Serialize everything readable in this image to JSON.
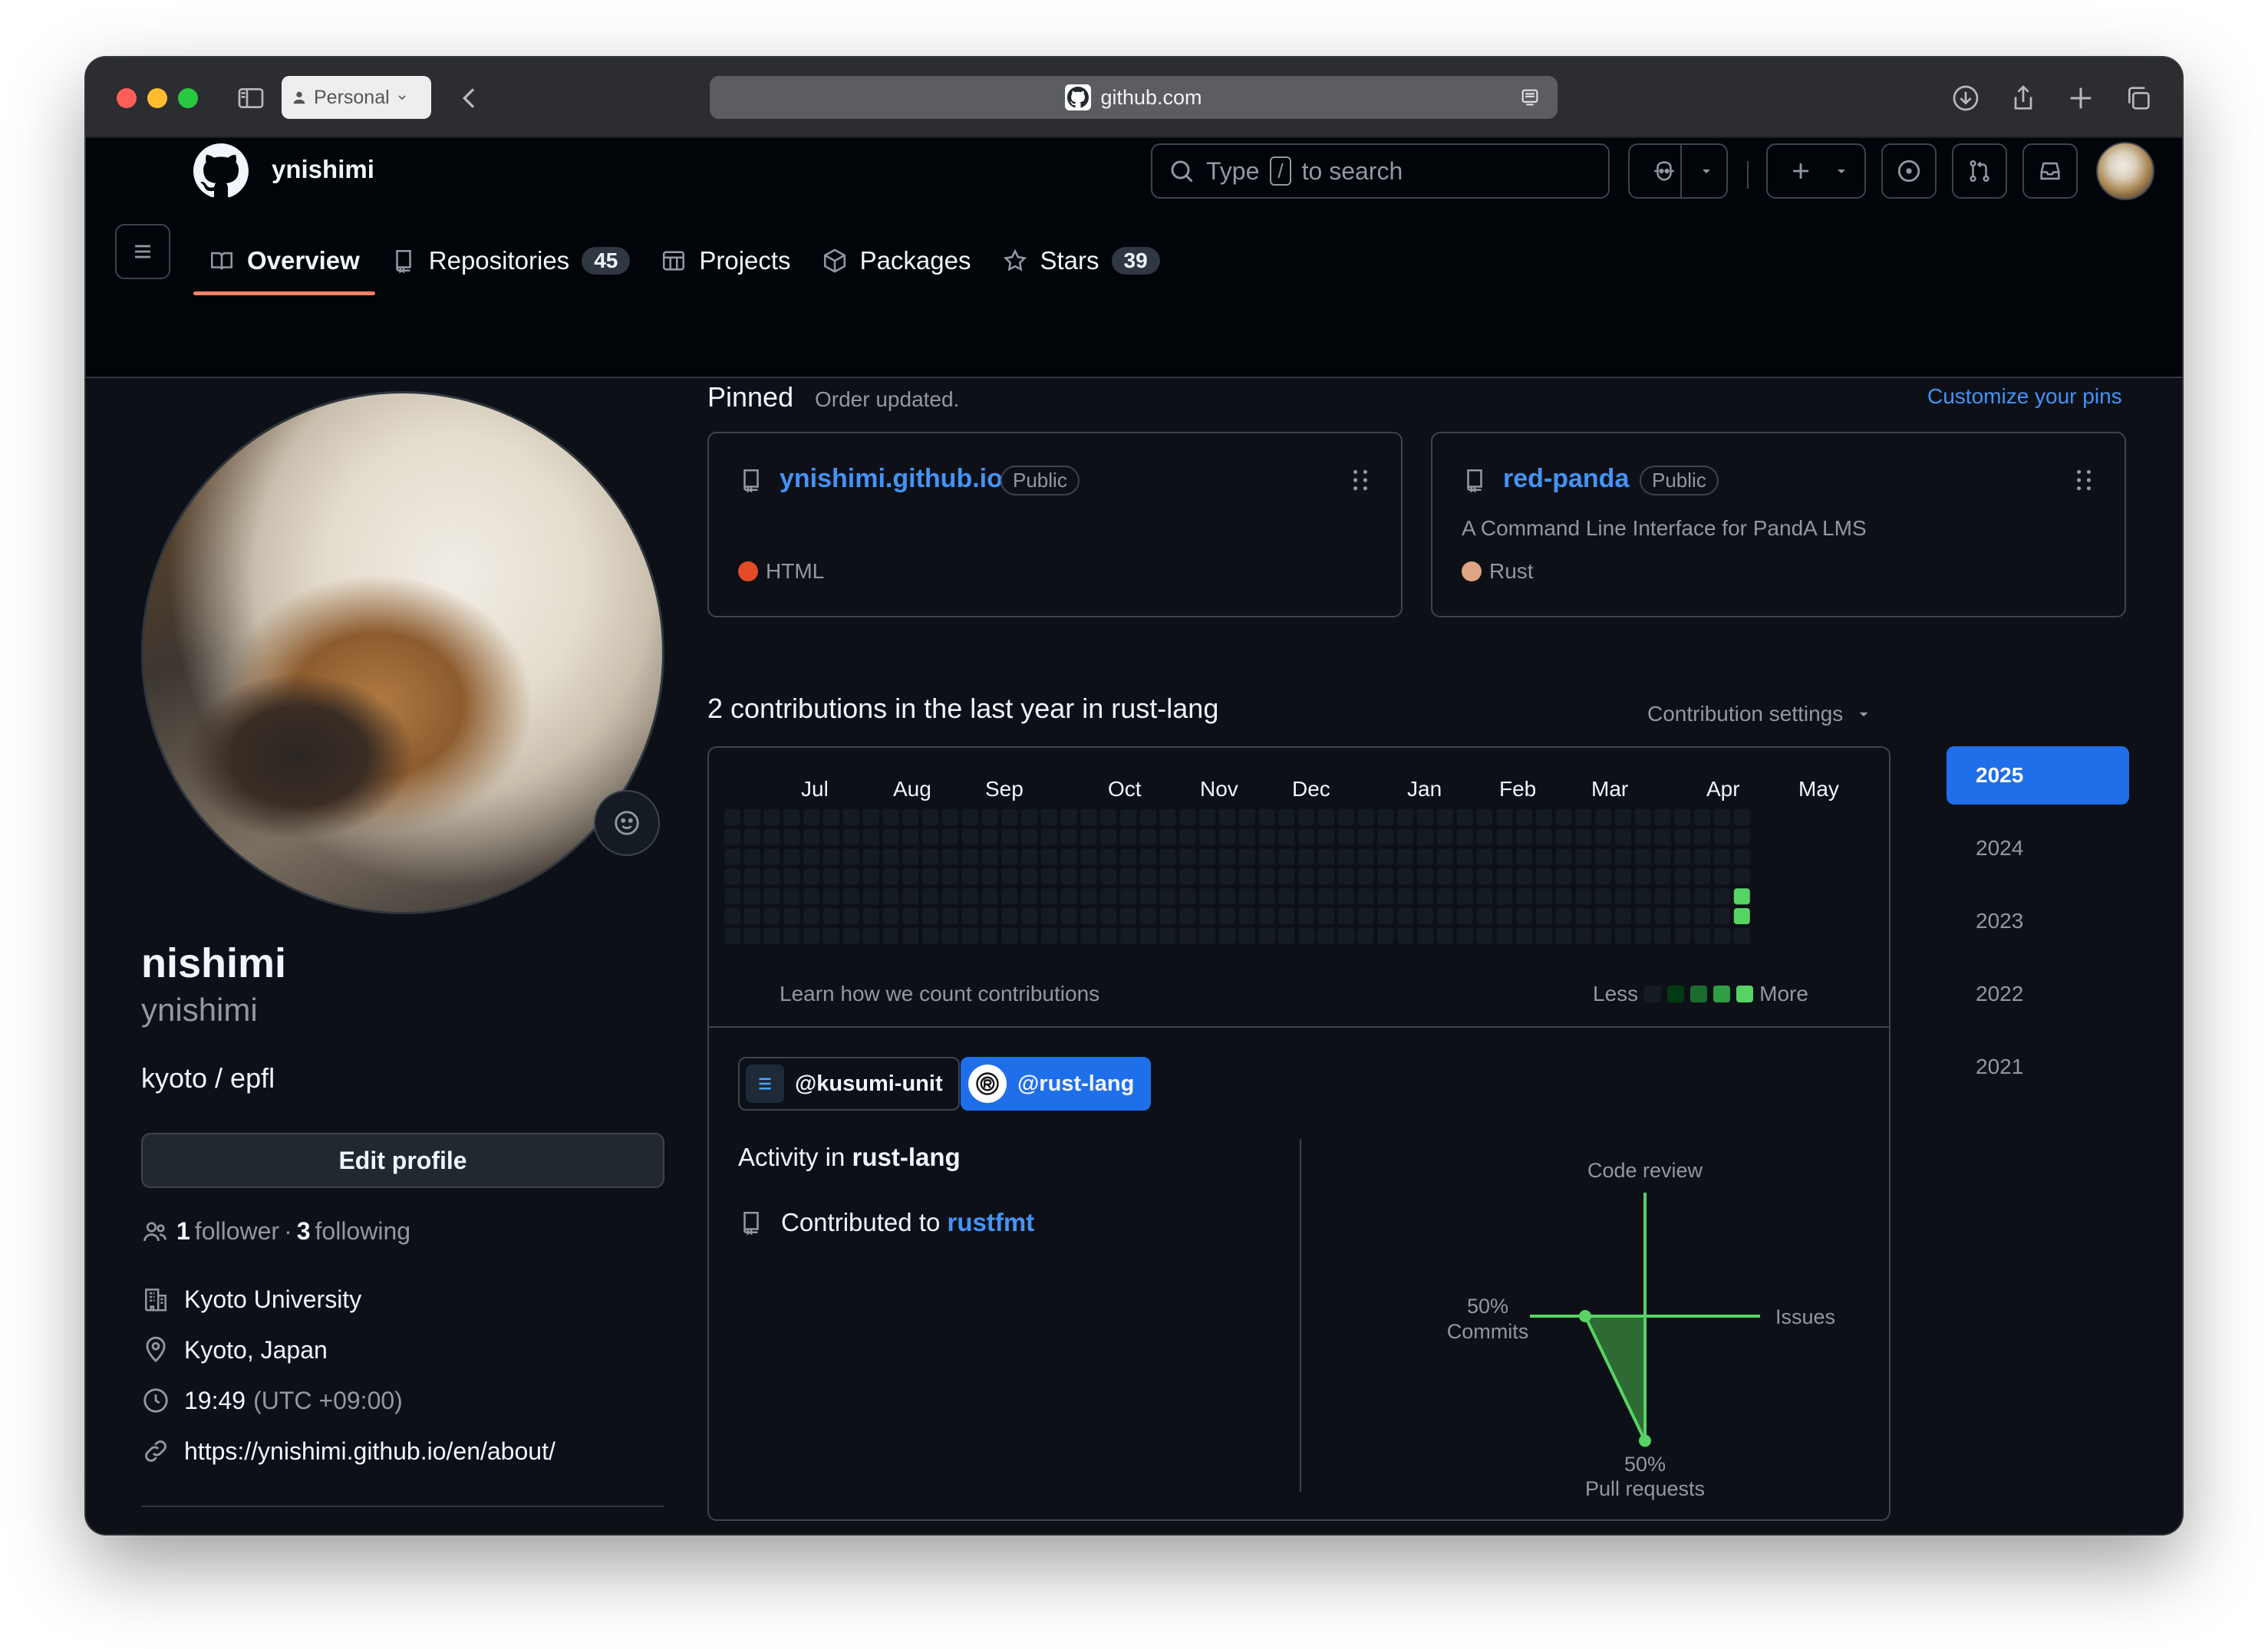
{
  "browser": {
    "profile_label": "Personal",
    "url": "github.com"
  },
  "header": {
    "username": "ynishimi",
    "search": {
      "prefix": "Type",
      "key": "/",
      "suffix": "to search"
    },
    "tabs": [
      {
        "label": "Overview",
        "count": "",
        "active": true
      },
      {
        "label": "Repositories",
        "count": "45"
      },
      {
        "label": "Projects",
        "count": ""
      },
      {
        "label": "Packages",
        "count": ""
      },
      {
        "label": "Stars",
        "count": "39"
      }
    ]
  },
  "profile": {
    "name": "nishimi",
    "login": "ynishimi",
    "bio": "kyoto / epfl",
    "edit_label": "Edit profile",
    "followers_count": "1",
    "followers_label": "follower",
    "separator": "·",
    "following_count": "3",
    "following_label": "following",
    "organization": "Kyoto University",
    "location": "Kyoto, Japan",
    "local_time": "19:49",
    "timezone": "(UTC +09:00)",
    "website": "https://ynishimi.github.io/en/about/"
  },
  "pinned": {
    "title": "Pinned",
    "note": "Order updated.",
    "customize_label": "Customize your pins",
    "repos": [
      {
        "name": "ynishimi.github.io",
        "visibility": "Public",
        "description": "",
        "language": "HTML",
        "language_color": "#e34c26"
      },
      {
        "name": "red-panda",
        "visibility": "Public",
        "description": "A Command Line Interface for PandA LMS",
        "language": "Rust",
        "language_color": "#dea584"
      }
    ]
  },
  "contributions": {
    "title": "2 contributions in the last year in rust-lang",
    "settings_label": "Contribution settings",
    "months": [
      "Jul",
      "Aug",
      "Sep",
      "Oct",
      "Nov",
      "Dec",
      "Jan",
      "Feb",
      "Mar",
      "Apr",
      "May"
    ],
    "learn_label": "Learn how we count contributions",
    "legend_less": "Less",
    "legend_more": "More",
    "legend_colors": [
      "#151b23",
      "#033a16",
      "#196c2e",
      "#2ea043",
      "#56d364"
    ],
    "active_cells": [
      {
        "week": 51,
        "day": 4,
        "level": 4
      },
      {
        "week": 51,
        "day": 5,
        "level": 4
      }
    ],
    "orgs": [
      {
        "label": "@kusumi-unit",
        "active": false
      },
      {
        "label": "@rust-lang",
        "active": true
      }
    ],
    "activity_prefix": "Activity in",
    "activity_org": "rust-lang",
    "contributed_prefix": "Contributed to",
    "contributed_repo": "rustfmt",
    "years": [
      "2025",
      "2024",
      "2023",
      "2022",
      "2021"
    ],
    "active_year": "2025"
  },
  "chart_data": {
    "type": "radar",
    "axes": [
      "Code review",
      "Issues",
      "Pull requests",
      "Commits"
    ],
    "values": [
      0,
      0,
      50,
      50
    ],
    "labels": {
      "commits": "50%",
      "pull_requests": "50%"
    },
    "colors": {
      "axis": "#56d364",
      "fill": "#2f6a34"
    }
  }
}
